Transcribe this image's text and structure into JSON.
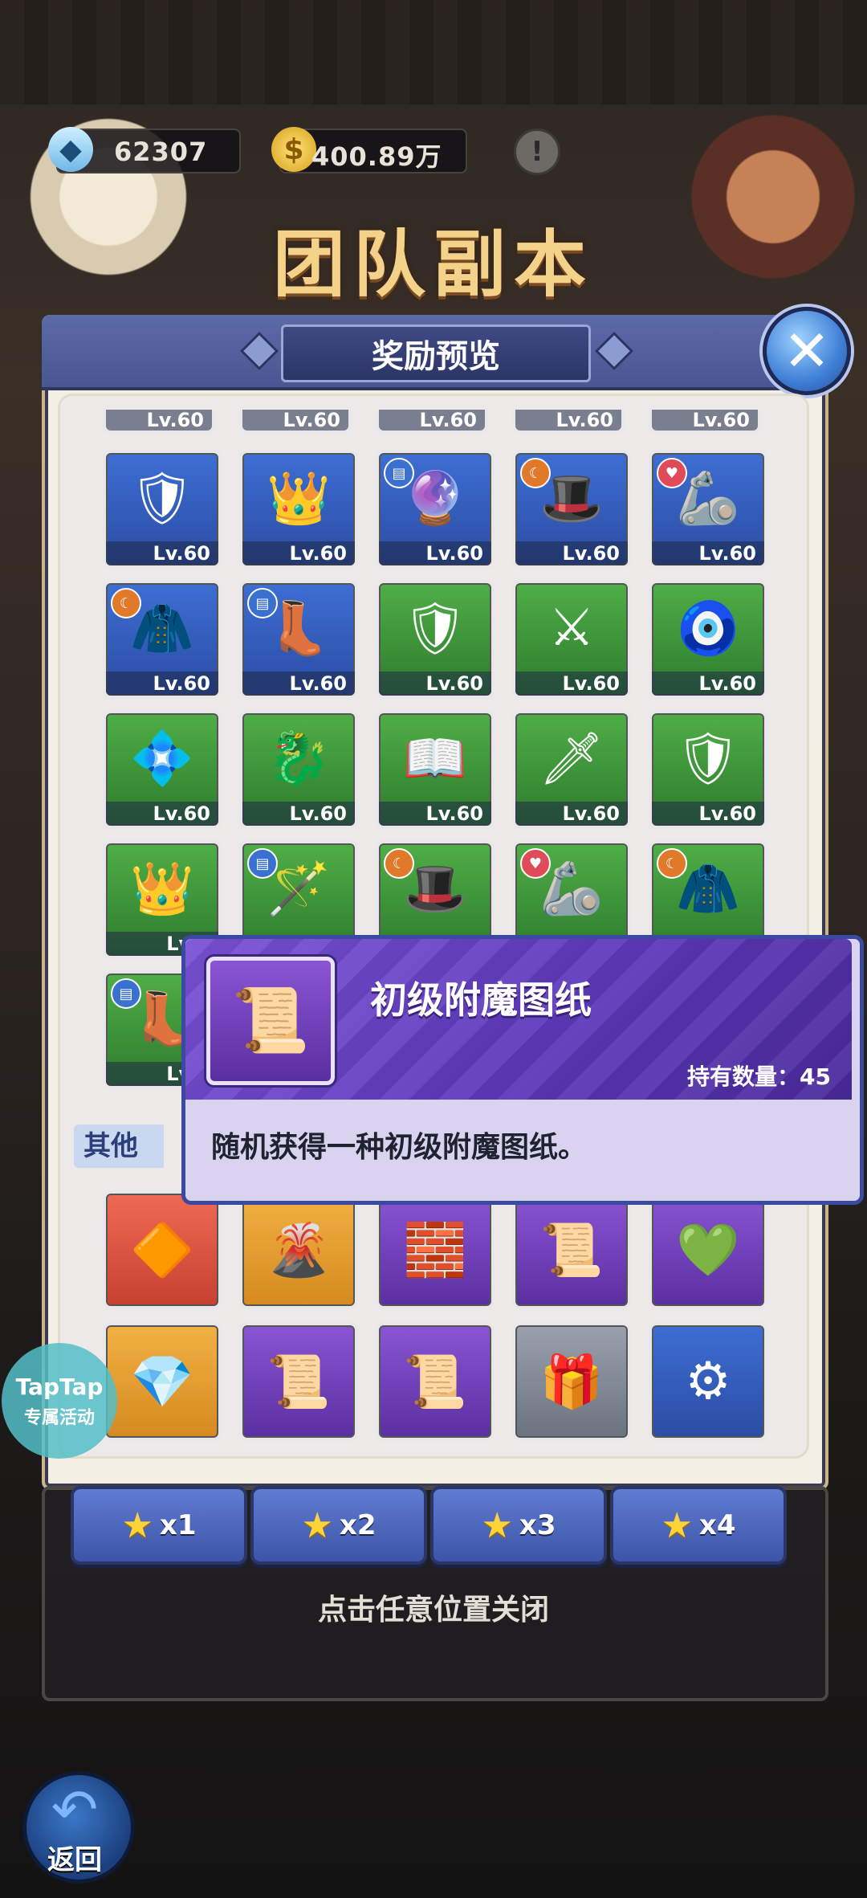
{
  "hud": {
    "gems": "62307",
    "gold": "400.89万",
    "gem_icon": "gem-icon",
    "gold_icon": "coin-icon",
    "info_glyph": "!"
  },
  "background": {
    "title": "团队副本"
  },
  "dialog": {
    "title": "奖励预览",
    "close_glyph": "✕",
    "partial_level": "Lv.60",
    "equipment": [
      {
        "bg": "blue",
        "icon": "🛡",
        "level": "Lv.60",
        "badge": ""
      },
      {
        "bg": "blue",
        "icon": "👑",
        "level": "Lv.60",
        "badge": ""
      },
      {
        "bg": "blue",
        "icon": "🔮",
        "level": "Lv.60",
        "badge": "book"
      },
      {
        "bg": "blue",
        "icon": "🎩",
        "level": "Lv.60",
        "badge": "moon"
      },
      {
        "bg": "blue",
        "icon": "🦾",
        "level": "Lv.60",
        "badge": "heart"
      },
      {
        "bg": "blue",
        "icon": "🧥",
        "level": "Lv.60",
        "badge": "moon"
      },
      {
        "bg": "blue",
        "icon": "👢",
        "level": "Lv.60",
        "badge": "book"
      },
      {
        "bg": "green",
        "icon": "🛡",
        "level": "Lv.60",
        "badge": ""
      },
      {
        "bg": "green",
        "icon": "⚔",
        "level": "Lv.60",
        "badge": ""
      },
      {
        "bg": "green",
        "icon": "🧿",
        "level": "Lv.60",
        "badge": ""
      },
      {
        "bg": "green",
        "icon": "💠",
        "level": "Lv.60",
        "badge": ""
      },
      {
        "bg": "green",
        "icon": "🐉",
        "level": "Lv.60",
        "badge": ""
      },
      {
        "bg": "green",
        "icon": "📖",
        "level": "Lv.60",
        "badge": ""
      },
      {
        "bg": "green",
        "icon": "🗡",
        "level": "Lv.60",
        "badge": ""
      },
      {
        "bg": "green",
        "icon": "🛡",
        "level": "Lv.60",
        "badge": ""
      },
      {
        "bg": "green",
        "icon": "👑",
        "level": "Lv.6",
        "badge": ""
      },
      {
        "bg": "green",
        "icon": "🪄",
        "level": "",
        "badge": "book"
      },
      {
        "bg": "green",
        "icon": "🎩",
        "level": "",
        "badge": "moon"
      },
      {
        "bg": "green",
        "icon": "🦾",
        "level": "",
        "badge": "heart"
      },
      {
        "bg": "green",
        "icon": "🧥",
        "level": "",
        "badge": "moon"
      },
      {
        "bg": "green",
        "icon": "👢",
        "level": "Lv.6",
        "badge": "book"
      }
    ],
    "section_others": "其他",
    "others": [
      {
        "bg": "red",
        "icon": "🔶"
      },
      {
        "bg": "orange",
        "icon": "🌋"
      },
      {
        "bg": "purple",
        "icon": "🧱"
      },
      {
        "bg": "purple",
        "icon": "📜"
      },
      {
        "bg": "purple",
        "icon": "💚"
      },
      {
        "bg": "orange",
        "icon": "💎"
      },
      {
        "bg": "purple",
        "icon": "📜"
      },
      {
        "bg": "purple",
        "icon": "📜"
      },
      {
        "bg": "gray",
        "icon": "🎁"
      },
      {
        "bg": "blue",
        "icon": "⚙"
      }
    ]
  },
  "tooltip": {
    "item_icon": "📜",
    "name": "初级附魔图纸",
    "quantity_label": "持有数量：45",
    "description": "随机获得一种初级附魔图纸。"
  },
  "star_tabs": [
    {
      "star": "★",
      "label": "x1"
    },
    {
      "star": "★",
      "label": "x2"
    },
    {
      "star": "★",
      "label": "x3"
    },
    {
      "star": "★",
      "label": "x4"
    }
  ],
  "bottom": {
    "close_hint": "点击任意位置关闭",
    "back_label": "返回",
    "back_glyph": "↶"
  },
  "taptap": {
    "line1": "TapTap",
    "line2": "专属活动"
  }
}
